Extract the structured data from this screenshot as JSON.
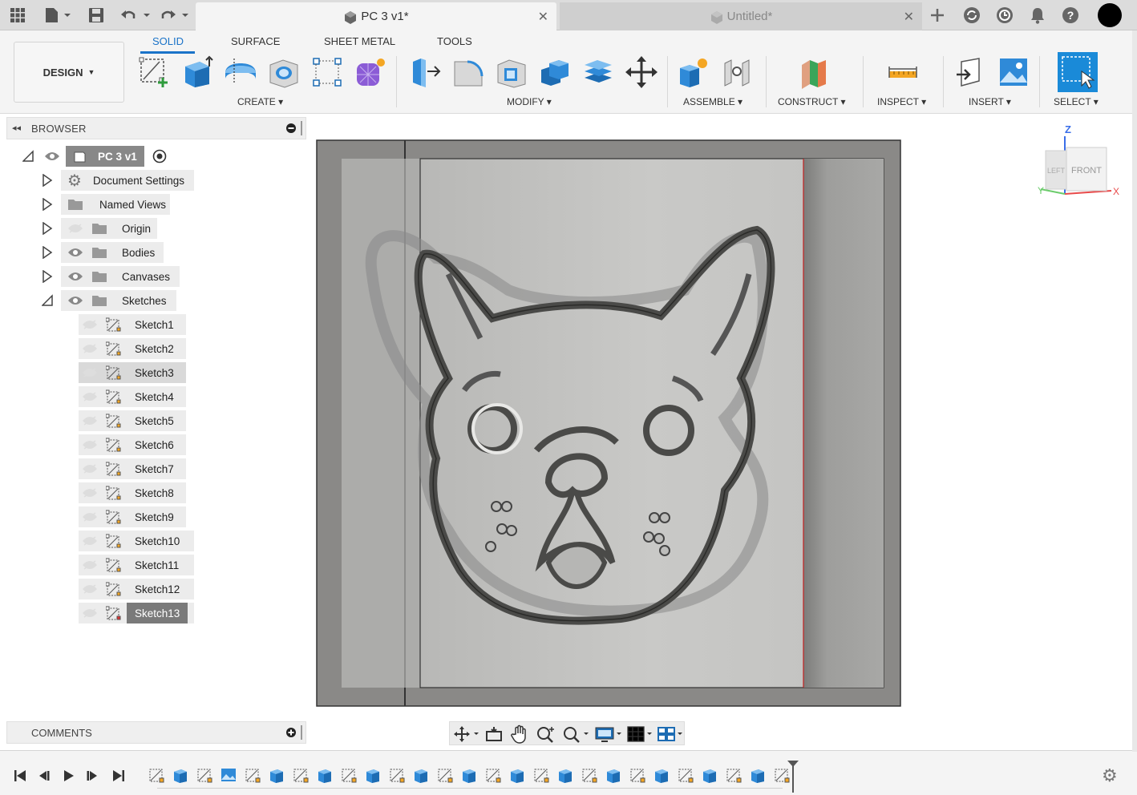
{
  "app": {
    "active_tab": {
      "title": "PC 3 v1*"
    },
    "inactive_tab": {
      "title": "Untitled*"
    }
  },
  "toolbar": {
    "workspace_button": "DESIGN",
    "workspace_tabs": [
      "SOLID",
      "SURFACE",
      "SHEET METAL",
      "TOOLS"
    ],
    "active_workspace_tab": "SOLID",
    "groups": {
      "create": "CREATE",
      "modify": "MODIFY",
      "assemble": "ASSEMBLE",
      "construct": "CONSTRUCT",
      "inspect": "INSPECT",
      "insert": "INSERT",
      "select": "SELECT"
    }
  },
  "browser": {
    "title": "BROWSER",
    "root": "PC 3 v1",
    "folders": [
      "Document Settings",
      "Named Views",
      "Origin",
      "Bodies",
      "Canvases",
      "Sketches"
    ],
    "sketches": [
      "Sketch1",
      "Sketch2",
      "Sketch3",
      "Sketch4",
      "Sketch5",
      "Sketch6",
      "Sketch7",
      "Sketch8",
      "Sketch9",
      "Sketch10",
      "Sketch11",
      "Sketch12",
      "Sketch13"
    ],
    "selected_sketch": "Sketch3",
    "active_sketch": "Sketch13"
  },
  "comments": {
    "title": "COMMENTS"
  },
  "viewcube": {
    "face_front": "FRONT",
    "face_left": "LEFT",
    "axis_z": "Z",
    "axis_x": "X",
    "axis_y": "Y"
  },
  "colors": {
    "accent": "#1a73c8",
    "sketch_active_bg": "#7a7a7a",
    "panel_bg": "#f4f4f4"
  }
}
